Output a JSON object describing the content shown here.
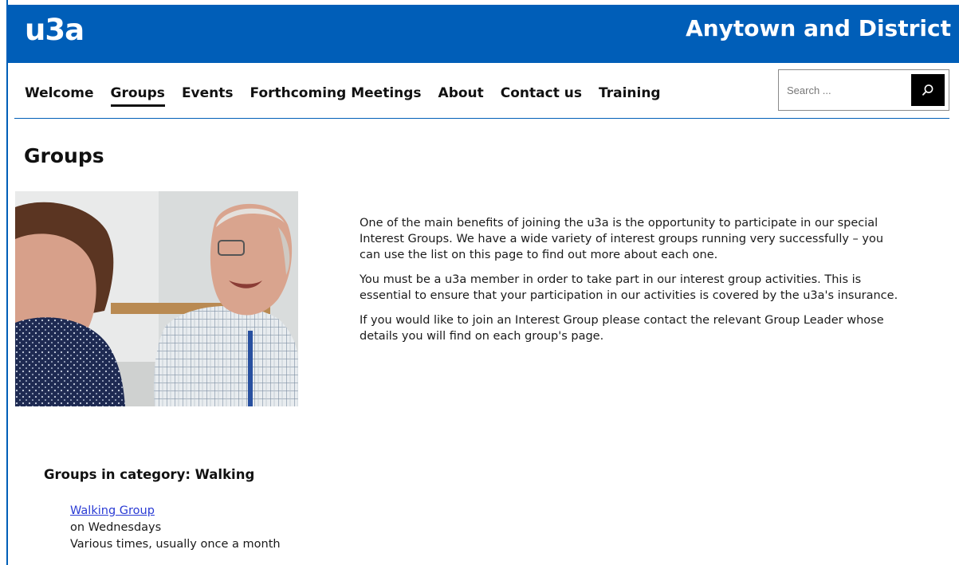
{
  "header": {
    "logo_text": "u3a",
    "site_title": "Anytown and District"
  },
  "nav": {
    "items": [
      {
        "label": "Welcome",
        "active": false
      },
      {
        "label": "Groups",
        "active": true
      },
      {
        "label": "Events",
        "active": false
      },
      {
        "label": "Forthcoming Meetings",
        "active": false
      },
      {
        "label": "About",
        "active": false
      },
      {
        "label": "Contact us",
        "active": false
      },
      {
        "label": "Training",
        "active": false
      }
    ]
  },
  "search": {
    "placeholder": "Search ...",
    "value": "",
    "button_icon": "search-icon"
  },
  "page": {
    "title": "Groups",
    "intro_paragraphs": [
      "One of the main benefits of joining the u3a is the opportunity to participate in our special Interest Groups. We have a wide variety of interest groups running very successfully – you can use the list on this page to find out more about each one.",
      "You must be a u3a member in order to take part in our interest group activities. This is essential to ensure that your participation in our activities is covered by the u3a's insurance.",
      "If you would like to join an Interest Group please contact the relevant Group Leader whose details you will find on each group's page."
    ]
  },
  "groups_section": {
    "heading": "Groups in category: Walking",
    "groups": [
      {
        "name": "Walking Group",
        "day": "on Wednesdays",
        "times": "Various times, usually once a month"
      }
    ]
  },
  "colors": {
    "brand_blue": "#005eb8",
    "link": "#2a3bd4",
    "search_button": "#000000"
  }
}
